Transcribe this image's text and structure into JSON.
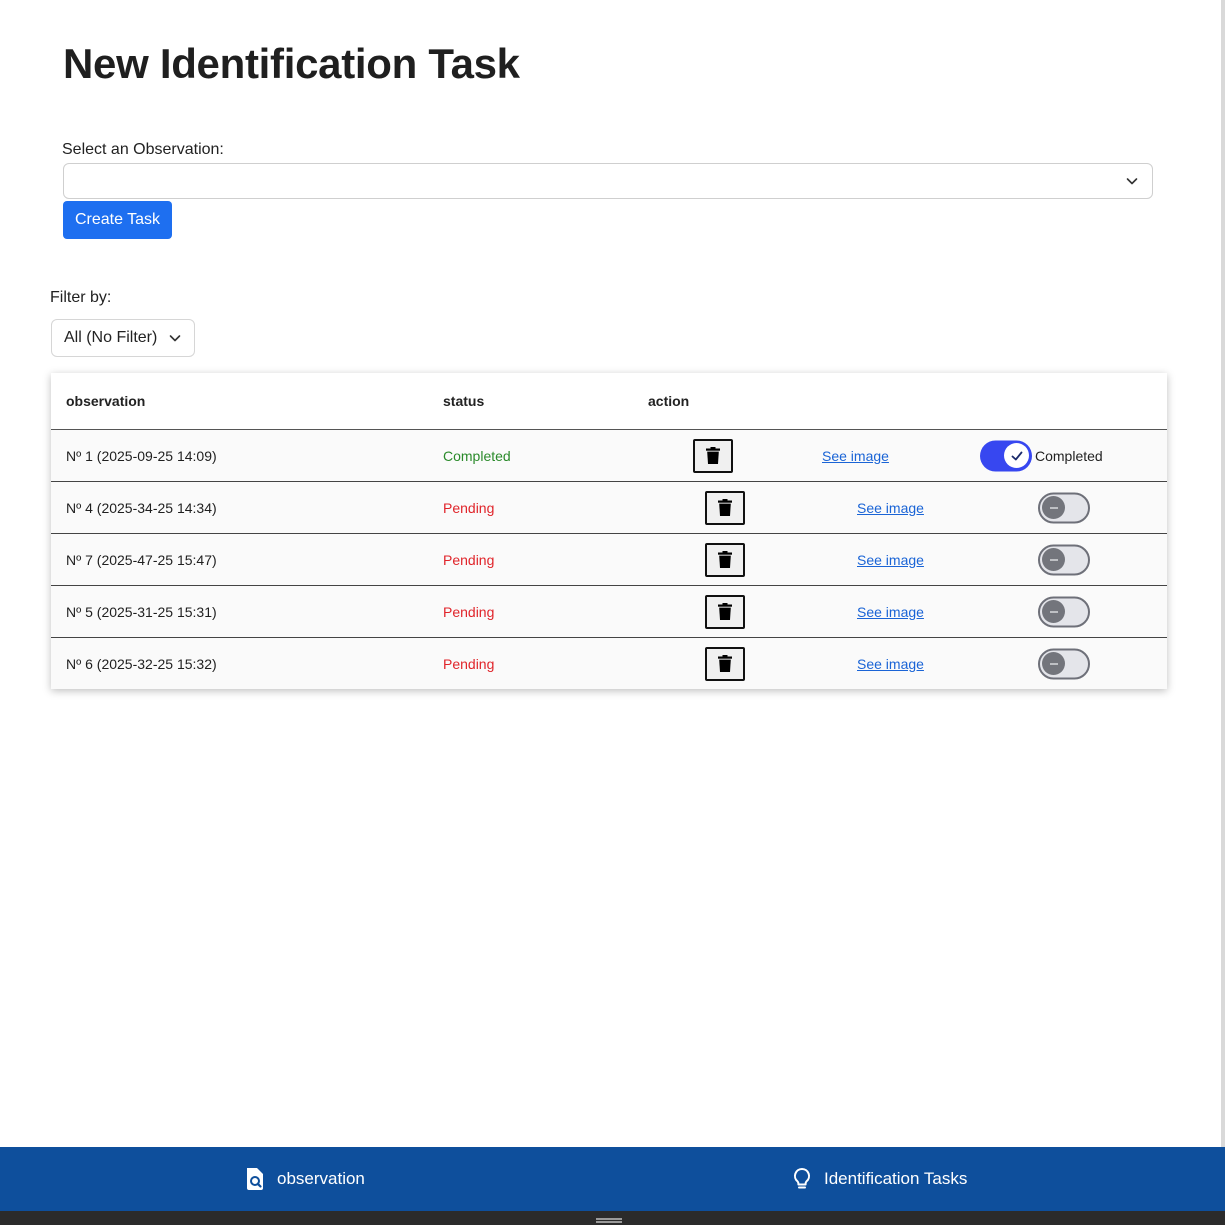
{
  "page": {
    "title": "New Identification Task"
  },
  "form": {
    "select_label": "Select an Observation:",
    "selected_value": "",
    "create_button": "Create Task"
  },
  "filter": {
    "label": "Filter by:",
    "value": "All (No Filter)"
  },
  "table": {
    "headers": {
      "observation": "observation",
      "status": "status",
      "action": "action"
    },
    "rows": [
      {
        "observation": "Nº 1 (2025-09-25 14:09)",
        "status": "Completed",
        "link": "See image",
        "toggle_on": true,
        "toggle_label": "Completed"
      },
      {
        "observation": "Nº 4 (2025-34-25 14:34)",
        "status": "Pending",
        "link": "See image",
        "toggle_on": false,
        "toggle_label": ""
      },
      {
        "observation": "Nº 7 (2025-47-25 15:47)",
        "status": "Pending",
        "link": "See image",
        "toggle_on": false,
        "toggle_label": ""
      },
      {
        "observation": "Nº 5 (2025-31-25 15:31)",
        "status": "Pending",
        "link": "See image",
        "toggle_on": false,
        "toggle_label": ""
      },
      {
        "observation": "Nº 6 (2025-32-25 15:32)",
        "status": "Pending",
        "link": "See image",
        "toggle_on": false,
        "toggle_label": ""
      }
    ]
  },
  "nav": {
    "observation_label": "observation",
    "observation_icon": "search-document-icon",
    "tasks_label": "Identification Tasks",
    "tasks_icon": "lightbulb-icon"
  },
  "colors": {
    "primary": "#1e6ff0",
    "nav_bg": "#0e4f9c",
    "completed": "#2a8a2a",
    "pending": "#e0242a",
    "toggle_on": "#3747f0",
    "link": "#1a64d6"
  }
}
